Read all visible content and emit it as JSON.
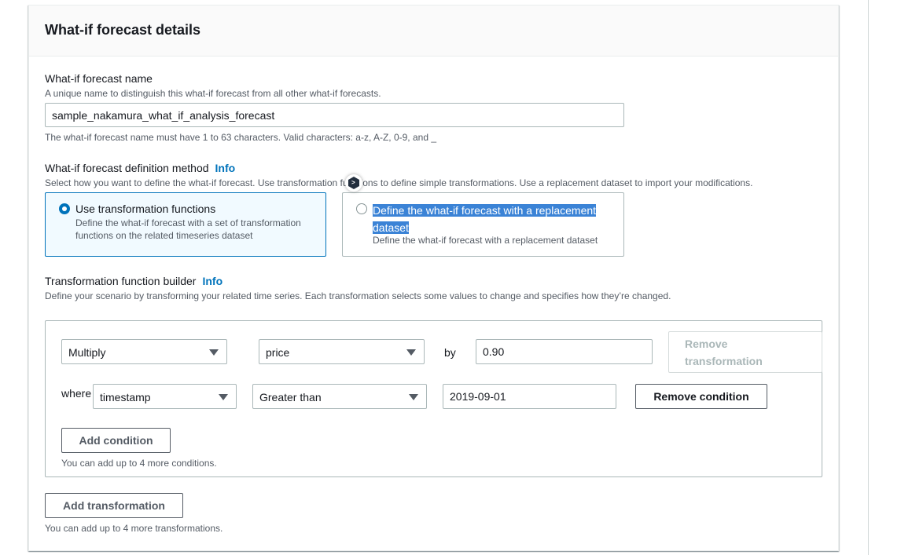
{
  "section": {
    "title": "What-if forecast details"
  },
  "name_field": {
    "label": "What-if forecast name",
    "description": "A unique name to distinguish this what-if forecast from all other what-if forecasts.",
    "value": "sample_nakamura_what_if_analysis_forecast",
    "constraint": "The what-if forecast name must have 1 to 63 characters. Valid characters: a-z, A-Z, 0-9, and _"
  },
  "method": {
    "label": "What-if forecast definition method",
    "info": "Info",
    "description": "Select how you want to define the what-if forecast. Use transformation functions to define simple transformations. Use a replacement dataset to import your modifications.",
    "options": [
      {
        "title": "Use transformation functions",
        "description_line1": "Define the what-if forecast with a set of transformation",
        "description_line2": "functions on the related timeseries dataset",
        "selected": true
      },
      {
        "title_line1": "Define the what-if forecast with a replacement",
        "title_line2": "dataset",
        "description": "Define the what-if forecast with a replacement dataset",
        "selected": false
      }
    ]
  },
  "builder": {
    "label": "Transformation function builder",
    "info": "Info",
    "description": "Define your scenario by transforming your related time series. Each transformation selects some values to change and specifies how they’re changed.",
    "transformation": {
      "operation": "Multiply",
      "attribute": "price",
      "by_label": "by",
      "value": "0.90",
      "remove_transformation_line1": "Remove",
      "remove_transformation_line2": "transformation"
    },
    "condition": {
      "where_label": "where",
      "attribute": "timestamp",
      "operator": "Greater than",
      "value": "2019-09-01",
      "remove_label": "Remove condition"
    },
    "add_condition_label": "Add condition",
    "conditions_hint": "You can add up to 4 more conditions."
  },
  "add_transformation_label": "Add transformation",
  "transformations_hint": "You can add up to 4 more transformations.",
  "colors": {
    "accent": "#0073bb",
    "selection_highlight": "#3b83d6",
    "selected_tile_bg": "#f1faff"
  }
}
